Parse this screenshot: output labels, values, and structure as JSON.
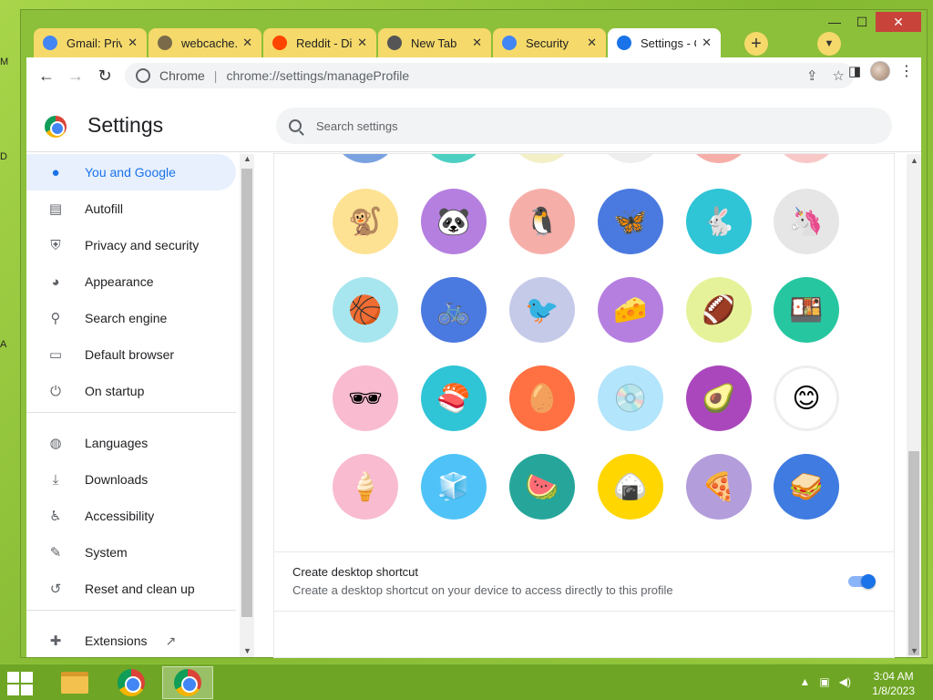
{
  "window": {
    "controls": {
      "minimize": "—",
      "maximize": "☐",
      "close": "✕"
    }
  },
  "tabs": [
    {
      "label": "Gmail: Priva",
      "favicon": "google-icon",
      "color": "#4285f4"
    },
    {
      "label": "webcache.g",
      "favicon": "globe-icon",
      "color": "#7a6a4a"
    },
    {
      "label": "Reddit - Div",
      "favicon": "reddit-icon",
      "color": "#ff4500"
    },
    {
      "label": "New Tab",
      "favicon": "chrome-icon",
      "color": "#555555"
    },
    {
      "label": "Security",
      "favicon": "google-icon",
      "color": "#4285f4"
    },
    {
      "label": "Settings - C",
      "favicon": "gear-icon",
      "color": "#1a73e8",
      "active": true
    }
  ],
  "toolbar": {
    "site_label": "Chrome",
    "url": "chrome://settings/manageProfile"
  },
  "settings": {
    "title": "Settings",
    "search_placeholder": "Search settings",
    "nav": [
      {
        "label": "You and Google",
        "icon": "person-icon",
        "active": true
      },
      {
        "label": "Autofill",
        "icon": "clipboard-icon"
      },
      {
        "label": "Privacy and security",
        "icon": "shield-icon"
      },
      {
        "label": "Appearance",
        "icon": "palette-icon"
      },
      {
        "label": "Search engine",
        "icon": "search-icon"
      },
      {
        "label": "Default browser",
        "icon": "browser-icon"
      },
      {
        "label": "On startup",
        "icon": "power-icon"
      },
      {
        "label": "Languages",
        "icon": "globe-icon"
      },
      {
        "label": "Downloads",
        "icon": "download-icon"
      },
      {
        "label": "Accessibility",
        "icon": "accessibility-icon"
      },
      {
        "label": "System",
        "icon": "wrench-icon"
      },
      {
        "label": "Reset and clean up",
        "icon": "history-icon"
      },
      {
        "label": "Extensions",
        "icon": "puzzle-icon"
      }
    ],
    "avatars": [
      {
        "name": "monkey-avatar",
        "bg": "#fde293",
        "glyph": "🐒"
      },
      {
        "name": "panda-avatar",
        "bg": "#b57fe0",
        "glyph": "🐼"
      },
      {
        "name": "penguin-avatar",
        "bg": "#f6aea9",
        "glyph": "🐧"
      },
      {
        "name": "butterfly-avatar",
        "bg": "#4a79e0",
        "glyph": "🦋"
      },
      {
        "name": "rabbit-avatar",
        "bg": "#2fc4d6",
        "glyph": "🐇"
      },
      {
        "name": "unicorn-avatar",
        "bg": "#e6e6e6",
        "glyph": "🦄"
      },
      {
        "name": "basketball-avatar",
        "bg": "#a8e6ef",
        "glyph": "🏀"
      },
      {
        "name": "bike-avatar",
        "bg": "#4a79e0",
        "glyph": "🚲"
      },
      {
        "name": "bird-avatar",
        "bg": "#c5cae9",
        "glyph": "🐦"
      },
      {
        "name": "cheese-avatar",
        "bg": "#b57fe0",
        "glyph": "🧀"
      },
      {
        "name": "football-avatar",
        "bg": "#e6f29a",
        "glyph": "🏈"
      },
      {
        "name": "sushi-plate-avatar",
        "bg": "#26c6a0",
        "glyph": "🍱"
      },
      {
        "name": "sunglasses-avatar",
        "bg": "#f8bbd0",
        "glyph": "🕶"
      },
      {
        "name": "sushi-avatar",
        "bg": "#2fc4d6",
        "glyph": "🍣"
      },
      {
        "name": "tamagotchi-avatar",
        "bg": "#ff7043",
        "glyph": "🥚"
      },
      {
        "name": "vinyl-avatar",
        "bg": "#b3e5fc",
        "glyph": "💿"
      },
      {
        "name": "avocado-avatar",
        "bg": "#ab47bc",
        "glyph": "🥑"
      },
      {
        "name": "smile-avatar",
        "bg": "#ffffff",
        "glyph": "😊"
      },
      {
        "name": "ice-cream-avatar",
        "bg": "#f8bbd0",
        "glyph": "🍦"
      },
      {
        "name": "ice-avatar",
        "bg": "#4fc3f7",
        "glyph": "🧊"
      },
      {
        "name": "watermelon-avatar",
        "bg": "#26a69a",
        "glyph": "🍉"
      },
      {
        "name": "onigiri-avatar",
        "bg": "#ffd600",
        "glyph": "🍙"
      },
      {
        "name": "pizza-avatar",
        "bg": "#b39ddb",
        "glyph": "🍕"
      },
      {
        "name": "sandwich-avatar",
        "bg": "#3f7be0",
        "glyph": "🥪"
      }
    ],
    "shortcut": {
      "title": "Create desktop shortcut",
      "description": "Create a desktop shortcut on your device to access directly to this profile",
      "enabled": true
    }
  },
  "taskbar": {
    "time": "3:04 AM",
    "date": "1/8/2023",
    "tray_arrow": "▲"
  }
}
